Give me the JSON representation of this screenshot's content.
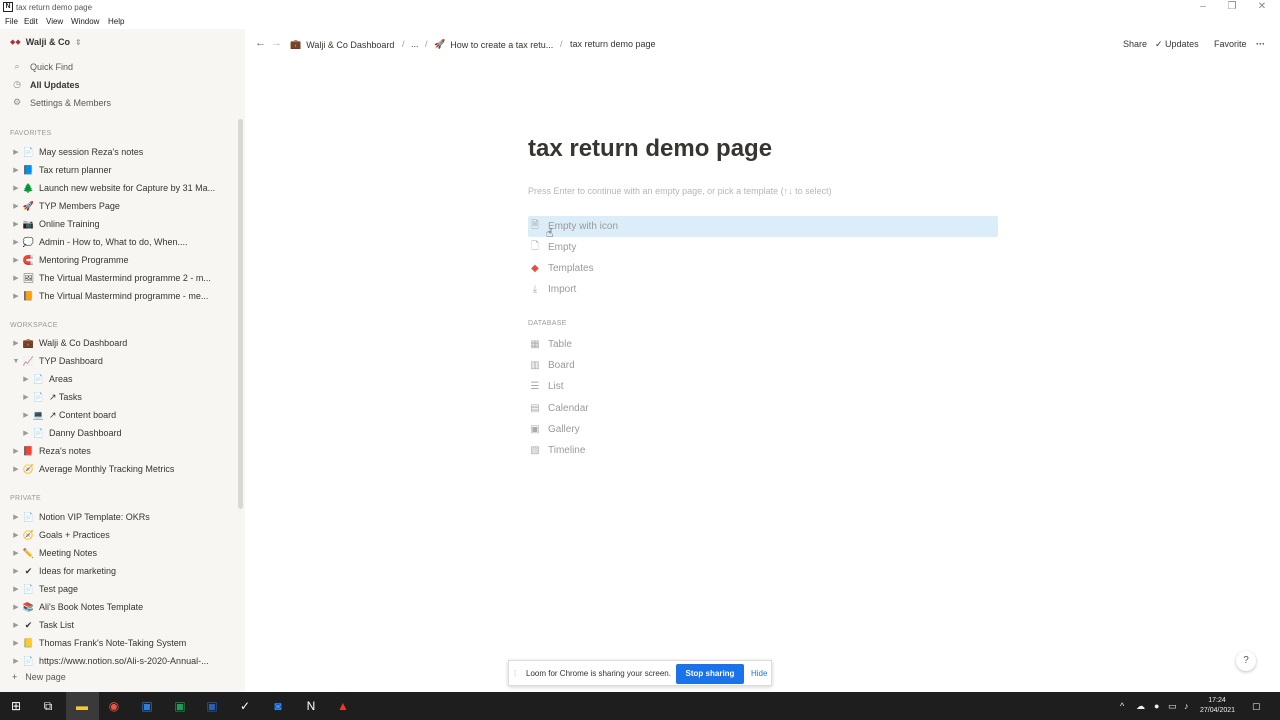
{
  "window": {
    "title": "tax return demo page"
  },
  "menu": [
    "File",
    "Edit",
    "View",
    "Window",
    "Help"
  ],
  "workspace": {
    "name": "Walji & Co"
  },
  "sidebar": {
    "links": [
      {
        "icon": "search-icon",
        "glyph": "⌕",
        "label": "Quick Find"
      },
      {
        "icon": "clock-icon",
        "glyph": "◷",
        "label": "All Updates"
      },
      {
        "icon": "gear-icon",
        "glyph": "⚙",
        "label": "Settings & Members"
      }
    ],
    "favorites_label": "FAVORITES",
    "favorites": [
      {
        "emoji": "📄",
        "label": "May session Reza's notes"
      },
      {
        "emoji": "📘",
        "label": "Tax return planner"
      },
      {
        "emoji": "🌲",
        "label": "Launch new website for Capture by 31 Ma..."
      },
      {
        "emoji": "🚀",
        "label": "TYP Members Page"
      },
      {
        "emoji": "📷",
        "label": "Online Training"
      },
      {
        "emoji": "💭",
        "label": "Admin - How to, What to do, When...."
      },
      {
        "emoji": "🧲",
        "label": "Mentoring Programme"
      },
      {
        "emoji": "🖼",
        "label": "The Virtual Mastermind programme 2 - m..."
      },
      {
        "emoji": "📙",
        "label": "The Virtual Mastermind programme - me..."
      }
    ],
    "workspace_label": "WORKSPACE",
    "workspace_items": [
      {
        "emoji": "💼",
        "label": "Walji & Co Dashboard",
        "level": 0,
        "open": false
      },
      {
        "emoji": "📈",
        "label": "TYP Dashboard",
        "level": 0,
        "open": true
      },
      {
        "emoji": "📄",
        "label": "Areas",
        "level": 1,
        "open": false
      },
      {
        "emoji": "📄",
        "label": "↗ Tasks",
        "level": 1,
        "open": false
      },
      {
        "emoji": "💻",
        "label": "↗ Content board",
        "level": 1,
        "open": false
      },
      {
        "emoji": "📄",
        "label": "Danny Dashboard",
        "level": 1,
        "open": false
      },
      {
        "emoji": "📕",
        "label": "Reza's notes",
        "level": 0,
        "open": false
      },
      {
        "emoji": "🧭",
        "label": "Average Monthly Tracking Metrics",
        "level": 0,
        "open": false
      }
    ],
    "private_label": "PRIVATE",
    "private_items": [
      {
        "emoji": "📄",
        "label": "Notion VIP Template: OKRs"
      },
      {
        "emoji": "🧭",
        "label": "Goals + Practices"
      },
      {
        "emoji": "✏️",
        "label": "Meeting Notes"
      },
      {
        "emoji": "✔",
        "label": "Ideas for marketing"
      },
      {
        "emoji": "📄",
        "label": "Test page"
      },
      {
        "emoji": "📚",
        "label": "Ali's Book Notes Template"
      },
      {
        "emoji": "✔",
        "label": "Task List"
      },
      {
        "emoji": "📒",
        "label": "Thomas Frank's Note-Taking System"
      },
      {
        "emoji": "📄",
        "label": "https://www.notion.so/Ali-s-2020-Annual-..."
      }
    ],
    "new_page": "New page"
  },
  "topbar": {
    "crumbs": [
      "Walji & Co Dashboard",
      "...",
      "How to create a tax retu...",
      "tax return demo page"
    ],
    "share": "Share",
    "updates": "Updates",
    "favorite": "Favorite",
    "more": "···"
  },
  "page": {
    "title": "tax return demo page",
    "hint": "Press Enter to continue with an empty page, or pick a template (↑↓ to select)",
    "options": [
      "Empty with icon",
      "Empty",
      "Templates",
      "Import"
    ],
    "database_label": "DATABASE",
    "database_options": [
      "Table",
      "Board",
      "List",
      "Calendar",
      "Gallery",
      "Timeline"
    ]
  },
  "loom": {
    "message": "Loom for Chrome is sharing your screen.",
    "stop": "Stop sharing",
    "hide": "Hide"
  },
  "help": "?",
  "taskbar": {
    "time": "17:24",
    "date": "27/04/2021"
  },
  "colors": {
    "highlight": "#dbedf8",
    "loom_blue": "#1a73e8",
    "sidebar_bg": "#f7f6f3"
  }
}
